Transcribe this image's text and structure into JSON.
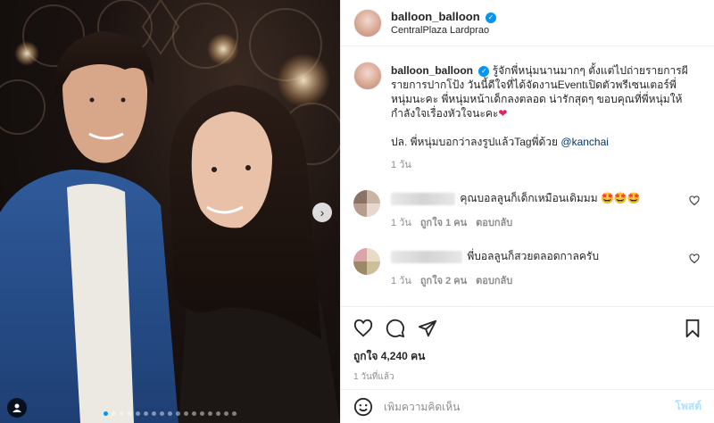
{
  "post": {
    "username": "balloon_balloon",
    "location": "CentralPlaza Lardprao",
    "caption_username": "balloon_balloon",
    "caption_text": "รู้จักพี่หนุ่มนานมากๆ ตั้งแต่ไปถ่ายรายการผี รายการปากโป้ง วันนี้ดีใจที่ได้จัดงานEventเปิดตัวพรีเซนเตอร์พี่หนุ่มนะคะ พี่หนุ่มหน้าเด็กลงตลอด น่ารักสุดๆ ขอบคุณที่พี่หนุ่มให้กำลังใจเรื่องหัวใจนะคะ",
    "caption_heart": "❤",
    "caption_ps": "ปล. พี่หนุ่มบอกว่าลงรูปแล้วTagพี่ด้วย",
    "caption_mention": "@kanchai",
    "caption_time": "1 วัน"
  },
  "comments": [
    {
      "text": "คุณบอลลูนก็เด็กเหมือนเดิมมม 🤩🤩🤩",
      "time": "1 วัน",
      "likes": "ถูกใจ 1 คน",
      "reply": "ตอบกลับ"
    },
    {
      "text": "พี่บอลลูนก็สวยตลอดกาลครับ",
      "time": "1 วัน",
      "likes": "ถูกใจ 2 คน",
      "reply": "ตอบกลับ"
    },
    {
      "text": "🤩🤩❤❤"
    }
  ],
  "actions": {
    "likes_label": "ถูกใจ 4,240 คน",
    "time_label": "1 วันที่แล้ว"
  },
  "add_comment": {
    "placeholder": "เพิ่มความคิดเห็น",
    "post_label": "โพสต์"
  },
  "carousel": {
    "total": 17,
    "active_index": 0
  },
  "colors": {
    "accent": "#0095f6",
    "text": "#262626",
    "muted": "#8e8e8e",
    "like_red": "#e0245e"
  },
  "icons": [
    "verified-badge-icon",
    "heart-icon",
    "comment-icon",
    "share-icon",
    "save-icon",
    "emoji-icon",
    "chevron-right-icon",
    "user-tag-icon"
  ]
}
